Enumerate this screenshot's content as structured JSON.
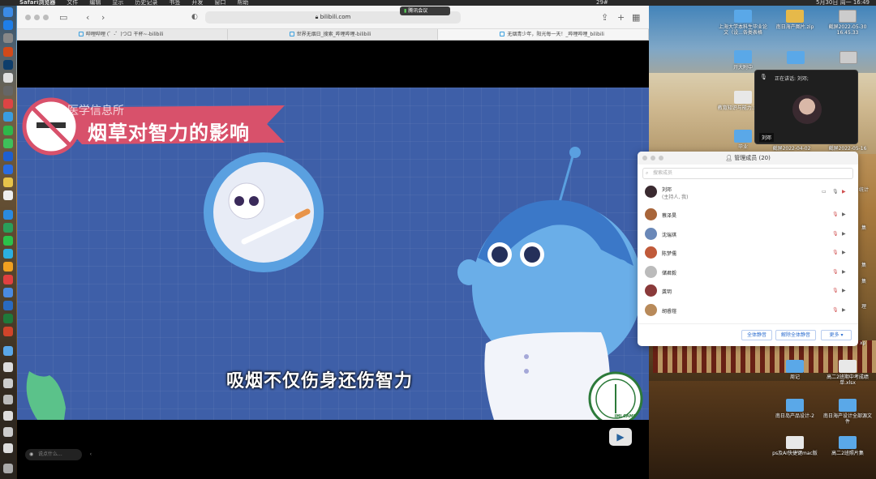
{
  "menubar": {
    "items": [
      "Safari浏览器",
      "文件",
      "编辑",
      "显示",
      "历史记录",
      "书签",
      "开发",
      "窗口",
      "帮助"
    ],
    "status": "29#",
    "clock": "5月30日 周一 16:49"
  },
  "browser": {
    "url": "bilibili.com",
    "meeting_pill": "腾讯会议",
    "tabs": [
      {
        "label": "哔哩哔哩 (゜-゜)つロ 干杯~-bilibili"
      },
      {
        "label": "世界无烟日_搜索_哔哩哔哩-bilibili"
      },
      {
        "label": "无烟青少年，阳光每一天！_哔哩哔哩_bilibili"
      }
    ]
  },
  "video": {
    "org_text": "医学信息所",
    "banner_title": "烟草对智力的影响",
    "subtitle": "吸烟不仅伤身还伤智力",
    "danmaku_placeholder": "说点什么...",
    "logo_text": "IMI.CAMS"
  },
  "speaker": {
    "header": "正在讲话: 刘邓;",
    "name": "刘邓"
  },
  "members_panel": {
    "title": "管理成员 (20)",
    "search_placeholder": "搜索成员",
    "host": {
      "name": "刘邓",
      "role": "(主持人, 我)"
    },
    "members": [
      {
        "name": "蔡泽昊",
        "color": "#a8653a"
      },
      {
        "name": "沈瑞琪",
        "color": "#6a88b8"
      },
      {
        "name": "陈梦儒",
        "color": "#c05a3a"
      },
      {
        "name": "储君毅",
        "color": "#bbbbbb"
      },
      {
        "name": "龚玥",
        "color": "#8a3a3a"
      },
      {
        "name": "胡睿煊",
        "color": "#b88a5a"
      }
    ],
    "buttons": {
      "mute_all": "全体静音",
      "unmute_all": "解除全体静音",
      "more": "更多 ▾"
    }
  },
  "desktop_icons": [
    {
      "label": "上海大学本科生毕业论文（设...各类表格",
      "kind": "folder"
    },
    {
      "label": "南日海产图片.zip",
      "kind": "zip"
    },
    {
      "label": "截屏2022-05-30 16.45.33",
      "kind": "shot"
    },
    {
      "label": "开大附中",
      "kind": "folder"
    },
    {
      "label": "教育知识与能力.xmind",
      "kind": "file"
    },
    {
      "label": "毕业",
      "kind": "folder"
    },
    {
      "label": "截屏2022-04-02",
      "kind": "shot"
    },
    {
      "label": "截屏2022-05-16",
      "kind": "shot"
    },
    {
      "label": "周记",
      "kind": "folder"
    },
    {
      "label": "高二2班期中考成绩单.xlsx",
      "kind": "file"
    },
    {
      "label": "南日岛产品设计-2",
      "kind": "folder"
    },
    {
      "label": "南日海产设计全部源文件",
      "kind": "folder"
    },
    {
      "label": "ps及AI快捷键mac版",
      "kind": "file"
    },
    {
      "label": "高二2班照片集",
      "kind": "folder"
    }
  ],
  "desktop_stubs": [
    "统计",
    "集",
    "集",
    "集",
    "理",
    "xp"
  ],
  "colors": {
    "banner": "#d8516b",
    "video_bg": "#3e5fa8",
    "accent": "#2f6fd0"
  }
}
